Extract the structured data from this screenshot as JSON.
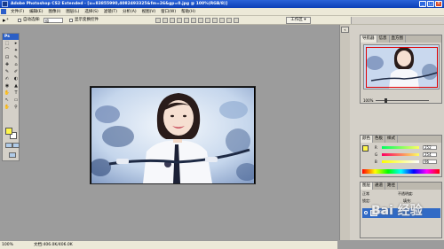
{
  "window": {
    "title": "Adobe Photoshop CS2 Extended - [u=83855990,4082493325&fm=26&gp=0.jpg @ 100%(RGB/8)]",
    "minimize_glyph": "_",
    "maximize_glyph": "□",
    "close_glyph": "×"
  },
  "menubar": {
    "items": [
      "文件(F)",
      "编辑(E)",
      "图像(I)",
      "图层(L)",
      "选择(S)",
      "滤镜(T)",
      "分析(A)",
      "视图(V)",
      "窗口(W)",
      "帮助(H)"
    ]
  },
  "options": {
    "tool_glyph": "▸⁺",
    "auto_select_label": "自动选择:",
    "auto_select_value": "组",
    "show_transform_label": "显示变换控件",
    "workspace_label": "工作区 ▾"
  },
  "toolbox": {
    "head": "Ps",
    "tools": [
      "⬚",
      "▸",
      "⌒",
      "✦",
      "⊡",
      "✎",
      "✚",
      "⌂",
      "✎",
      "✐",
      "✍",
      "◐",
      "◉",
      "▲",
      "✋",
      "T",
      "↖",
      "▭",
      "✋",
      "⚲"
    ],
    "fg_color": "#fff64a",
    "bg_color": "#ffffff"
  },
  "statusbar": {
    "zoom": "100%",
    "docinfo": "文档:406.0K/406.0K"
  },
  "navigator": {
    "tabs": [
      "导航器",
      "信息",
      "直方图"
    ],
    "zoom": "100%"
  },
  "color_panel": {
    "tabs": [
      "颜色",
      "色板",
      "样式"
    ],
    "swatch": "#fff64a",
    "channels": [
      {
        "label": "R",
        "value": "252"
      },
      {
        "label": "G",
        "value": "254"
      },
      {
        "label": "B",
        "value": "96"
      }
    ]
  },
  "layers": {
    "tabs": [
      "图层",
      "通道",
      "路径"
    ],
    "blend_mode": "正常",
    "opacity_label": "不透明度:",
    "lock_label": "锁定:",
    "fill_label": "填充:",
    "layer_name": "背景"
  },
  "watermark": "Bai 经验"
}
